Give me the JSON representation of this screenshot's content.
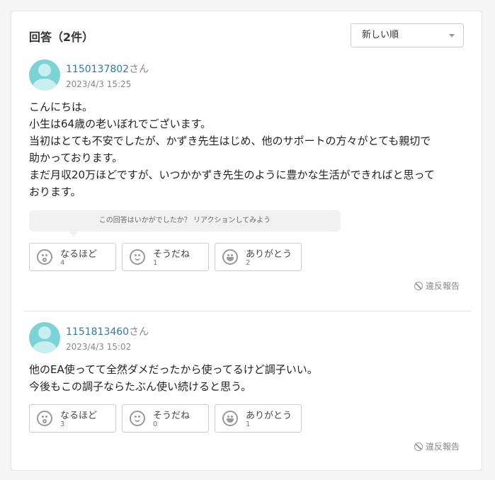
{
  "header": {
    "title": "回答（2件）",
    "sort_selected": "新しい順"
  },
  "prompt_text": "この回答はいかがでしたか？ リアクションしてみよう",
  "answers": [
    {
      "user_id": "1150137802",
      "honorific": "さん",
      "date": "2023/4/3 15:25",
      "lines": [
        "こんにちは。",
        "小生は64歳の老いぼれでございます。",
        "当初はとても不安でしたが、かずき先生はじめ、他のサポートの方々がとても親切で",
        "助かっております。",
        "まだ月収20万ほどですが、いつかかずき先生のように豊かな生活ができればと思って",
        "おります。"
      ],
      "reactions": [
        {
          "label": "なるほど",
          "count": "4",
          "icon": "surprised-face-icon"
        },
        {
          "label": "そうだね",
          "count": "1",
          "icon": "smile-face-icon"
        },
        {
          "label": "ありがとう",
          "count": "2",
          "icon": "grin-face-icon"
        }
      ],
      "report": "違反報告"
    },
    {
      "user_id": "1151813460",
      "honorific": "さん",
      "date": "2023/4/3 15:02",
      "lines": [
        "他のEA使ってて全然ダメだったから使ってるけど調子いい。",
        "今後もこの調子ならたぶん使い続けると思う。"
      ],
      "reactions": [
        {
          "label": "なるほど",
          "count": "3",
          "icon": "surprised-face-icon"
        },
        {
          "label": "そうだね",
          "count": "0",
          "icon": "smile-face-icon"
        },
        {
          "label": "ありがとう",
          "count": "1",
          "icon": "grin-face-icon"
        }
      ],
      "report": "違反報告"
    }
  ],
  "colors": {
    "user_link": "#2a7ab6",
    "avatar": "#7cd3d6"
  }
}
